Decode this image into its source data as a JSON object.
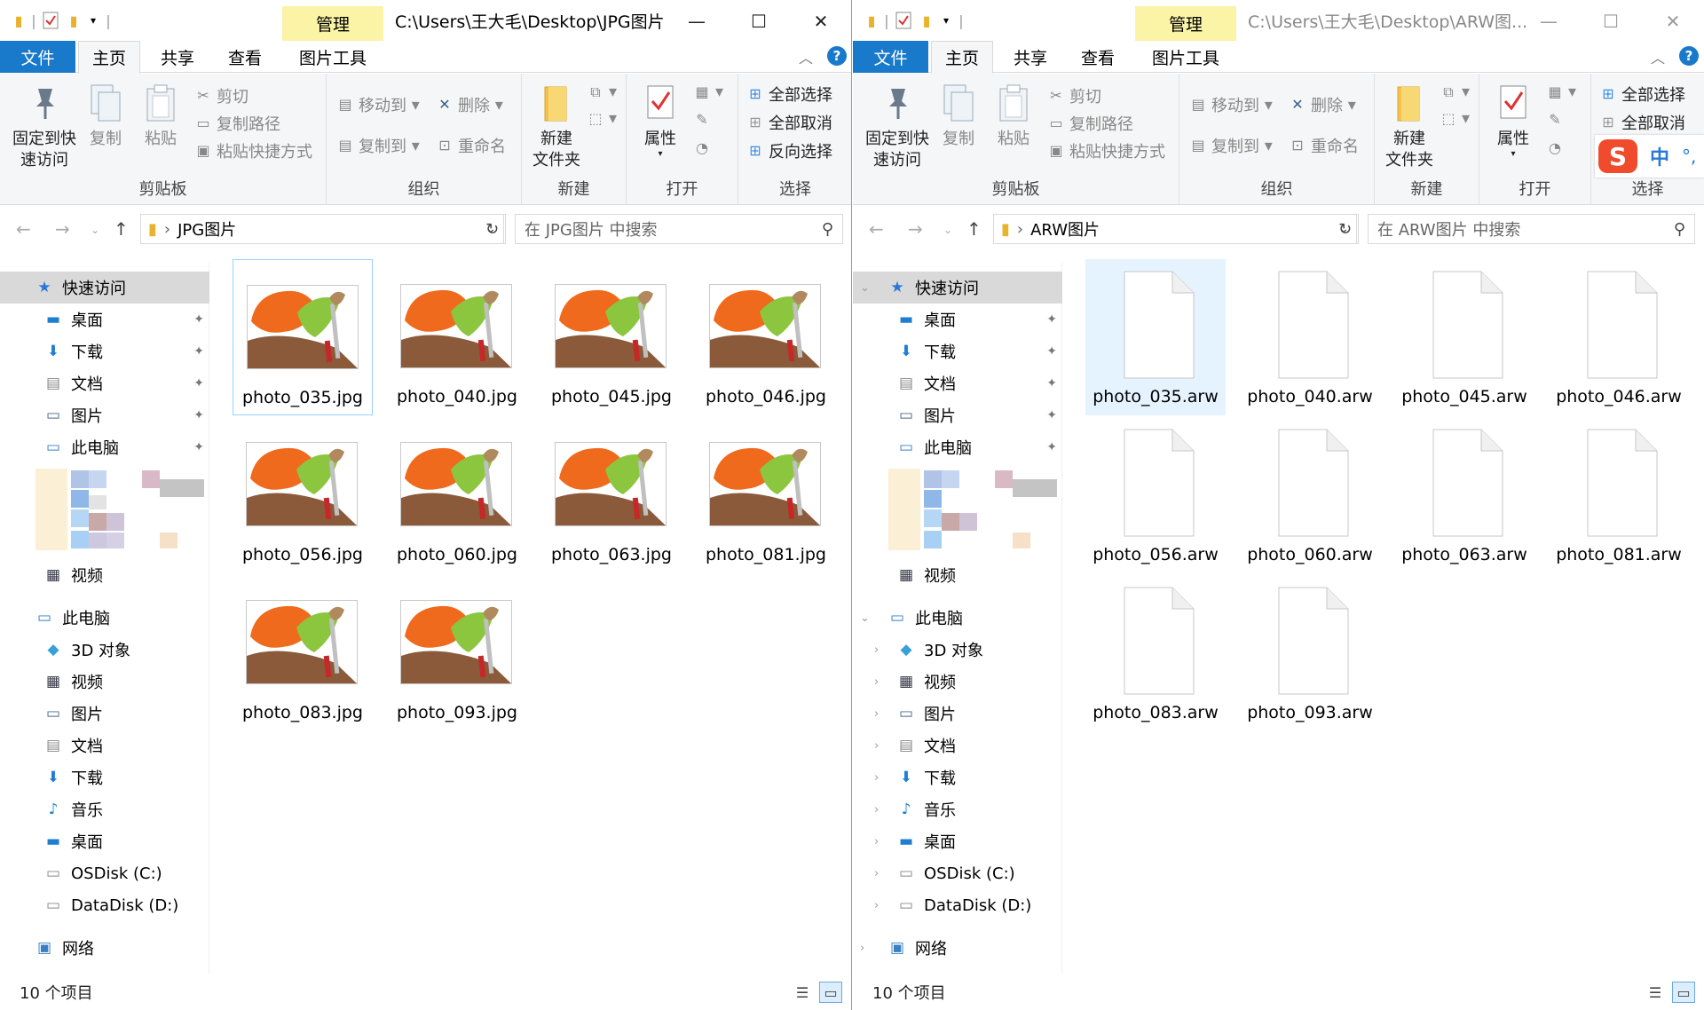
{
  "left": {
    "title": "C:\\Users\\王大毛\\Desktop\\JPG图片",
    "folder": "JPG图片",
    "search_placeholder": "在 JPG图片 中搜索",
    "status": "10 个项目",
    "files": [
      "photo_035.jpg",
      "photo_040.jpg",
      "photo_045.jpg",
      "photo_046.jpg",
      "photo_056.jpg",
      "photo_060.jpg",
      "photo_063.jpg",
      "photo_081.jpg",
      "photo_083.jpg",
      "photo_093.jpg"
    ]
  },
  "right": {
    "title": "C:\\Users\\王大毛\\Desktop\\ARW图...",
    "folder": "ARW图片",
    "search_placeholder": "在 ARW图片 中搜索",
    "status": "10 个项目",
    "files": [
      "photo_035.arw",
      "photo_040.arw",
      "photo_045.arw",
      "photo_046.arw",
      "photo_056.arw",
      "photo_060.arw",
      "photo_063.arw",
      "photo_081.arw",
      "photo_083.arw",
      "photo_093.arw"
    ]
  },
  "ribbon": {
    "context_tab": "管理",
    "tabs": {
      "file": "文件",
      "home": "主页",
      "share": "共享",
      "view": "查看",
      "tools": "图片工具"
    },
    "pin_quick": "固定到快\n速访问",
    "pin_l1": "固定到快",
    "pin_l2": "速访问",
    "copy": "复制",
    "paste": "粘贴",
    "cut": "剪切",
    "copy_path": "复制路径",
    "paste_shortcut": "粘贴快捷方式",
    "clipboard": "剪贴板",
    "move_to": "移动到",
    "copy_to": "复制到",
    "delete": "删除",
    "rename": "重命名",
    "organize": "组织",
    "new_folder_l1": "新建",
    "new_folder_l2": "文件夹",
    "new": "新建",
    "properties": "属性",
    "open": "打开",
    "select_all": "全部选择",
    "select_none": "全部取消",
    "invert_selection": "反向选择",
    "select": "选择"
  },
  "nav": {
    "quick_access": "快速访问",
    "qa_items": [
      "桌面",
      "下载",
      "文档",
      "图片",
      "此电脑"
    ],
    "videos": "视频",
    "this_pc": "此电脑",
    "pc_items": [
      "3D 对象",
      "视频",
      "图片",
      "文档",
      "下载",
      "音乐",
      "桌面",
      "OSDisk (C:)",
      "DataDisk (D:)"
    ],
    "network": "网络"
  },
  "ime": {
    "label": "中"
  },
  "colors": {
    "accent": "#1979ca",
    "context": "#fbf3a6",
    "selection": "#cce8ff"
  }
}
